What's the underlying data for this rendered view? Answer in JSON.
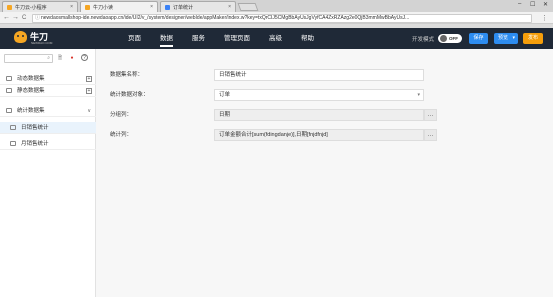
{
  "browser": {
    "tabs": [
      {
        "label": "牛刀云-小程序",
        "close": "×",
        "color": "#f5a623"
      },
      {
        "label": "牛刀小读",
        "close": "×",
        "color": "#f5a623"
      },
      {
        "label": "订单统计",
        "close": "×",
        "color": "#3b82f6"
      }
    ],
    "controls": {
      "minimize": "–",
      "maximize": "☐",
      "close": "✕"
    },
    "nav": {
      "back": "←",
      "forward": "→",
      "reload": "C"
    },
    "lock_icon": "ⓘ",
    "url": "newdaosmallshop-ide.newdaoapp.cn/ide/UI2/v_/system/designer/webIde/appMaker/index.w?key=txQrCIJ5CMgBbAyUsJgVyfCA4ZxRZAzg2e0QjB3mmMwBbAyUsJ...",
    "star": "☆",
    "menu": "⋮"
  },
  "header": {
    "logo_text": "牛刀",
    "logo_sub": "NEWDAO.COM",
    "nav": [
      "页面",
      "数据",
      "服务",
      "管理页面",
      "高级",
      "帮助"
    ],
    "active_nav": "数据",
    "dev_mode_label": "开发模式",
    "toggle_label": "OFF",
    "save_label": "保存",
    "preview_label": "预览",
    "preview_caret": "▾",
    "publish_label": "发布",
    "colors": {
      "bg": "#1f2937",
      "save": "#2d8cf0",
      "preview": "#2d8cf0",
      "publish": "#f59e0b"
    }
  },
  "sidebar": {
    "search_icon": "⌕",
    "icons": [
      "🗎",
      "●",
      "?"
    ],
    "items": [
      {
        "label": "动态数据集",
        "action": "+"
      },
      {
        "label": "静态数据集",
        "action": "+"
      },
      {
        "label": "统计数据集",
        "chevron": "∨"
      },
      {
        "label": "日销售统计"
      },
      {
        "label": "月销售统计"
      }
    ]
  },
  "form": {
    "rows": [
      {
        "label": "数据集名称：",
        "value": "日销售统计"
      },
      {
        "label": "统计数据对象：",
        "value": "订单",
        "caret": "▾"
      },
      {
        "label": "分组列：",
        "value": "日期",
        "button": "…"
      },
      {
        "label": "统计列：",
        "value": "订单金额合计[sum(fdingdanje)],日期[fnjdfnjd]",
        "button": "…"
      }
    ]
  }
}
